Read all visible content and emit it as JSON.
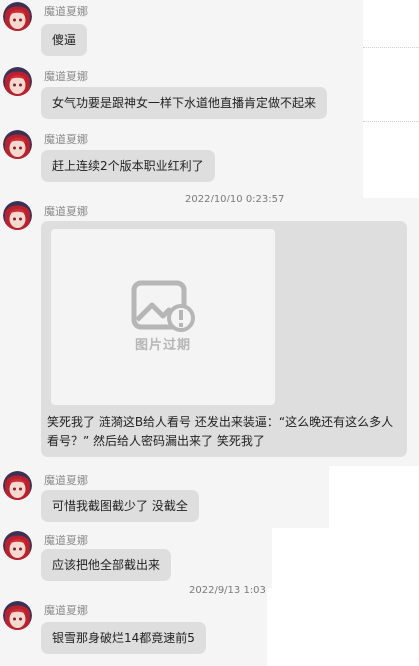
{
  "sender_name": "魔道夏娜",
  "timestamps": [
    "2022/10/10 0:23:57",
    "2022/9/13 1:03"
  ],
  "messages": [
    {
      "text": "傻逼"
    },
    {
      "text": "女气功要是跟神女一样下水道他直播肯定做不起来"
    },
    {
      "text": "赶上连续2个版本职业红利了"
    },
    {
      "image_label": "图片过期",
      "text": "笑死我了 涟漪这B给人看号  还发出来装逼：“这么晚还有这么多人看号？” 然后给人密码漏出来了 笑死我了"
    },
    {
      "text": "可惜我截图截少了 没截全"
    },
    {
      "text": "应该把他全部截出来"
    },
    {
      "text": "银雪那身破烂14都竟速前5"
    }
  ],
  "colors": {
    "bubble": "#dedede",
    "sender": "#8a8a8a",
    "text": "#222222",
    "image_placeholder": "#f4f4f4",
    "expired_icon": "#b6b6b6"
  }
}
